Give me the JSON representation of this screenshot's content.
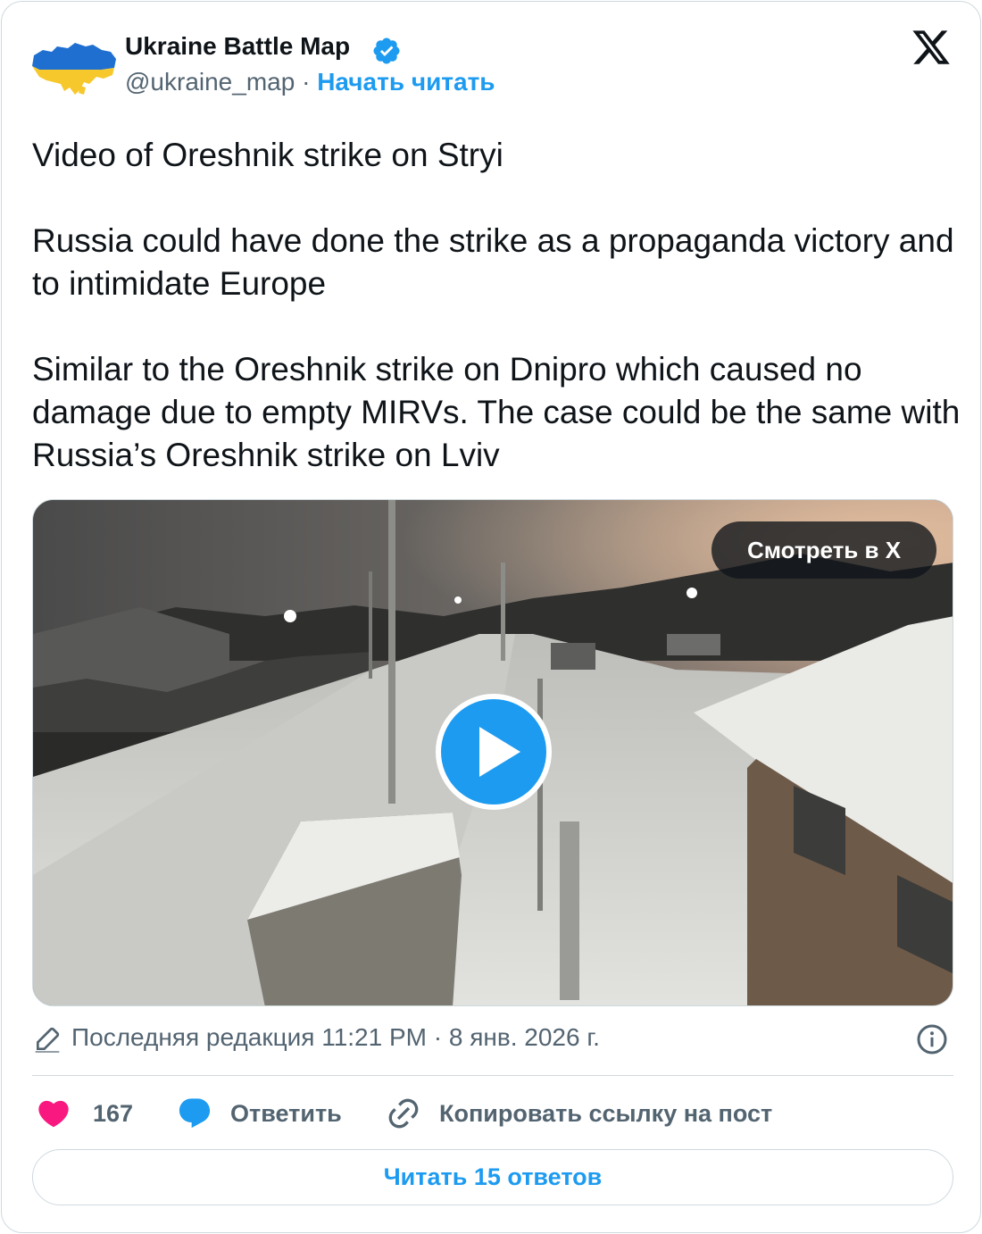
{
  "author": {
    "name": "Ukraine Battle Map",
    "handle": "@ukraine_map",
    "separator": "·",
    "follow_label": "Начать читать",
    "verified": true
  },
  "tweet": {
    "line1": "Video of Oreshnik strike on Stryi",
    "paragraph2": "Russia could have done the strike as a propaganda victory and to intimidate Europe",
    "paragraph3": "Similar to the Oreshnik strike on Dnipro which caused no damage due to empty MIRVs. The case could be the same with Russia’s Oreshnik strike on Lviv"
  },
  "media": {
    "watch_label": "Смотреть в X",
    "kind": "video"
  },
  "edit_info": {
    "text": "Последняя редакция 11:21 PM · 8 янв. 2026 г."
  },
  "actions": {
    "like_count": "167",
    "reply_label": "Ответить",
    "copy_link_label": "Копировать ссылку на пост"
  },
  "read_replies_label": "Читать 15 ответов",
  "colors": {
    "accent": "#1d9bf0",
    "like": "#f91880",
    "text": "#0f1419",
    "muted": "#536471",
    "border": "#cfd9de"
  },
  "icons": [
    "ukraine-map-avatar",
    "verified-badge-icon",
    "x-logo-icon",
    "ukraine-flag-icon",
    "play-icon",
    "pencil-icon",
    "info-icon",
    "heart-icon",
    "reply-bubble-icon",
    "link-icon"
  ]
}
